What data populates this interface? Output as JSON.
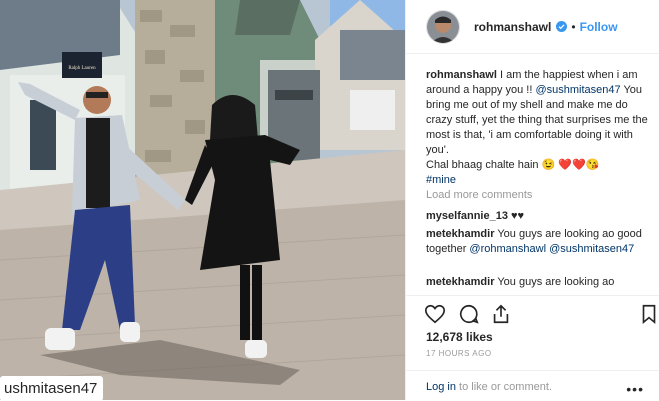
{
  "post": {
    "photo_tag": "ushmitasen47",
    "storefront_sign": "Ralph Lauren"
  },
  "header": {
    "username": "rohmanshawl",
    "dot": "•",
    "follow_label": "Follow"
  },
  "caption": {
    "username": "rohmanshawl",
    "text_before_mention": "I am the happiest when i am around a happy you !! ",
    "mention": "@sushmitasen47",
    "text_after_mention": "You bring me out of my shell and make me do crazy stuff, yet the thing that surprises me the most is that, 'i am comfortable doing it with you'.",
    "line2": "Chal bhaag chalte hain 😉 ❤️❤️😘",
    "hashtag": "#mine"
  },
  "load_more": "Load more comments",
  "comments": [
    {
      "user": "myselfannie_13",
      "text": "♥♥"
    },
    {
      "user": "metekhamdir",
      "text": "You guys are looking ao good together ",
      "mention1": "@rohmanshawl",
      "mention2": "@sushmitasen47"
    },
    {
      "user": "metekhamdir",
      "text": "You guys are looking ao"
    }
  ],
  "likes": "12,678 likes",
  "timestamp": "17 HOURS AGO",
  "footer": {
    "login_link": "Log in",
    "login_rest": " to like or comment.",
    "more": "•••"
  },
  "colors": {
    "accent": "#3897f0",
    "link": "#003569",
    "muted": "#999999",
    "text": "#262626"
  }
}
